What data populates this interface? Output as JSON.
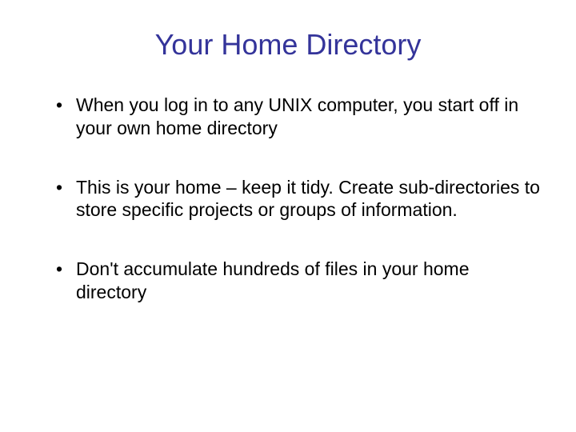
{
  "slide": {
    "title": "Your Home Directory",
    "bullets": [
      "When you log in to any UNIX computer, you start off in your own home directory",
      "This is your home – keep it tidy. Create sub-directories to store specific projects or groups of information.",
      "Don't accumulate hundreds of files in your home directory"
    ]
  }
}
